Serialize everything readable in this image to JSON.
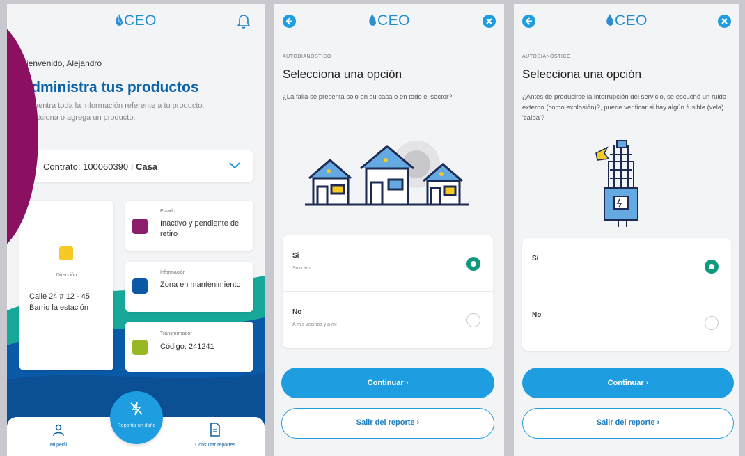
{
  "brand": {
    "logo_text": "CEO",
    "accent": "#1e9de0",
    "dark_blue": "#0c63a8",
    "purple": "#8b1061"
  },
  "home": {
    "greeting": "Bienvenido, Alejandro",
    "title": "Administra tus productos",
    "description": "Encuentra toda la información referente a tu producto. Selecciona o agrega un producto.",
    "contract": {
      "prefix": "Contrato: 100060390 I ",
      "type": "Casa"
    },
    "direccion": {
      "label": "Dirección",
      "value": "Calle 24 # 12 - 45 Barrio la estación"
    },
    "estado": {
      "label": "Estado",
      "value": "Inactivo y pendiente de retiro"
    },
    "informacion": {
      "label": "Información",
      "value": "Zona en mantenimiento"
    },
    "transformador": {
      "label": "Transformador",
      "value": "Código: 241241"
    },
    "nav": {
      "profile": "Mi perfil",
      "report": "Reportar un daño",
      "reports": "Consultar reportes"
    }
  },
  "step1": {
    "kicker": "AUTODIANÓSTICO",
    "title": "Selecciona una opción",
    "question": "¿La falla se presenta solo en su casa o en todo el sector?",
    "options": [
      {
        "label": "Si",
        "sub": "Solo ami",
        "selected": true
      },
      {
        "label": "No",
        "sub": "A mis vecinos y a mí",
        "selected": false
      }
    ],
    "continue_label": "Continuar ›",
    "exit_label": "Salir del reporte ›"
  },
  "step2": {
    "kicker": "AUTODIANÓSTICO",
    "title": "Selecciona una opción",
    "question": "¿Antes de producirse la interrupción del servicio, se escuchó un ruido externo (como explosión)?, puede verificar si hay algún fusible (vela) 'caída'?",
    "options": [
      {
        "label": "Si",
        "sub": "",
        "selected": true
      },
      {
        "label": "No",
        "sub": "",
        "selected": false
      }
    ],
    "continue_label": "Continuar ›",
    "exit_label": "Salir del reporte ›"
  }
}
